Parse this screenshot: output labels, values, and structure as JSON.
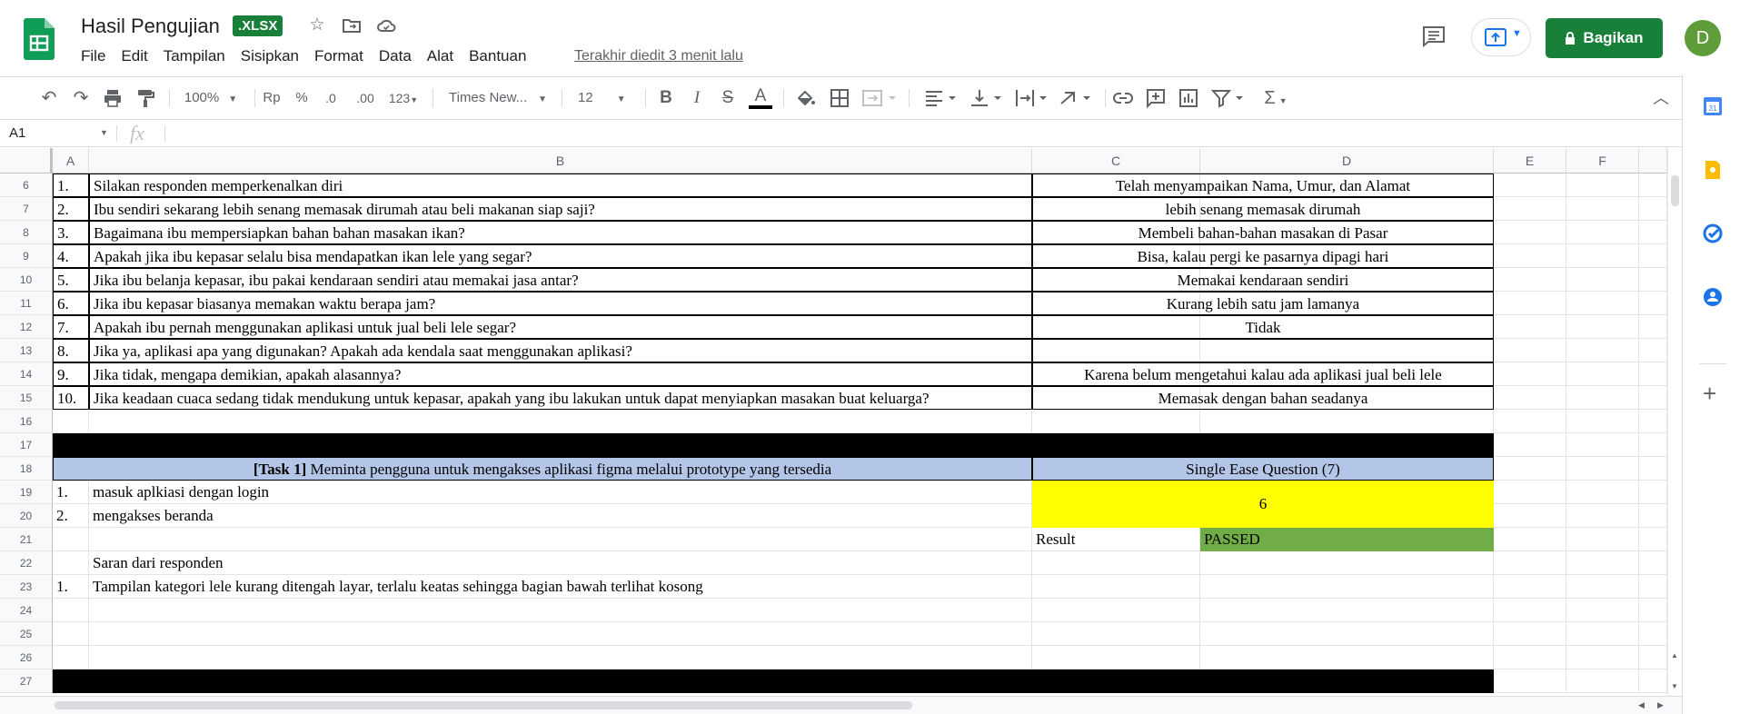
{
  "header": {
    "title": "Hasil Pengujian",
    "badge": ".XLSX",
    "menu": [
      "File",
      "Edit",
      "Tampilan",
      "Sisipkan",
      "Format",
      "Data",
      "Alat",
      "Bantuan"
    ],
    "last_edit": "Terakhir diedit 3 menit lalu",
    "share_label": "Bagikan",
    "avatar_letter": "D",
    "brand_color": "#188038"
  },
  "toolbar": {
    "zoom": "100%",
    "currency": "Rp",
    "percent": "%",
    "dec_less": ".0",
    "dec_more": ".00",
    "format_more": "123",
    "font": "Times New...",
    "font_size": "12",
    "bold": "B",
    "italic": "I",
    "strike": "S",
    "text_color": "A",
    "sigma": "Σ"
  },
  "formula_bar": {
    "name_box": "A1",
    "fx": "fx",
    "value": ""
  },
  "columns": [
    "A",
    "B",
    "C",
    "D",
    "E",
    "F"
  ],
  "rows": [
    {
      "num": "6",
      "a": "1.",
      "b": "Silakan responden memperkenalkan diri",
      "cd": "Telah menyampaikan Nama, Umur, dan Alamat"
    },
    {
      "num": "7",
      "a": "2.",
      "b": "Ibu sendiri sekarang lebih senang memasak dirumah atau beli makanan siap saji?",
      "cd": "lebih senang memasak dirumah"
    },
    {
      "num": "8",
      "a": "3.",
      "b": "Bagaimana ibu mempersiapkan bahan bahan masakan ikan?",
      "cd": "Membeli bahan-bahan masakan di Pasar"
    },
    {
      "num": "9",
      "a": "4.",
      "b": "Apakah jika ibu kepasar selalu bisa mendapatkan ikan lele yang segar?",
      "cd": "Bisa, kalau  pergi ke pasarnya dipagi hari"
    },
    {
      "num": "10",
      "a": "5.",
      "b": "Jika ibu belanja kepasar, ibu pakai kendaraan sendiri atau memakai jasa antar?",
      "cd": "Memakai kendaraan sendiri"
    },
    {
      "num": "11",
      "a": "6.",
      "b": "Jika ibu kepasar biasanya memakan waktu berapa jam?",
      "cd": "Kurang lebih satu jam lamanya"
    },
    {
      "num": "12",
      "a": "7.",
      "b": "Apakah ibu pernah menggunakan aplikasi untuk jual beli lele segar?",
      "cd": "Tidak"
    },
    {
      "num": "13",
      "a": "8.",
      "b": "Jika ya, aplikasi apa yang digunakan? Apakah ada kendala saat menggunakan aplikasi?",
      "cd": ""
    },
    {
      "num": "14",
      "a": "9.",
      "b": "Jika tidak, mengapa demikian, apakah alasannya?",
      "cd": "Karena belum mengetahui kalau ada aplikasi jual beli lele"
    },
    {
      "num": "15",
      "a": "10.",
      "b": "Jika keadaan cuaca sedang tidak mendukung untuk kepasar, apakah yang ibu lakukan untuk dapat menyiapkan masakan buat keluarga?",
      "cd": "Memasak dengan bahan seadanya"
    }
  ],
  "row_numbers_lower": [
    "16",
    "17",
    "18",
    "19",
    "20",
    "21",
    "22",
    "23",
    "24",
    "25",
    "26",
    "27"
  ],
  "task": {
    "label_bold": "[Task 1]",
    "label_rest": " Meminta pengguna untuk mengakses aplikasi figma melalui prototype yang tersedia",
    "seq_header": "Single Ease Question (7)",
    "steps": [
      {
        "a": "1.",
        "b": "masuk aplkiasi dengan login"
      },
      {
        "a": "2.",
        "b": "mengakses beranda"
      }
    ],
    "seq_value": "6",
    "result_label": "Result",
    "result_value": "PASSED",
    "feedback_title": "Saran dari responden",
    "feedback": [
      {
        "a": "1.",
        "b": "Tampilan kategori lele kurang ditengah layar, terlalu keatas sehingga bagian bawah terlihat kosong"
      }
    ],
    "header_color": "#b4c6e7",
    "seq_color": "#ffff00",
    "passed_color": "#70ad47"
  }
}
